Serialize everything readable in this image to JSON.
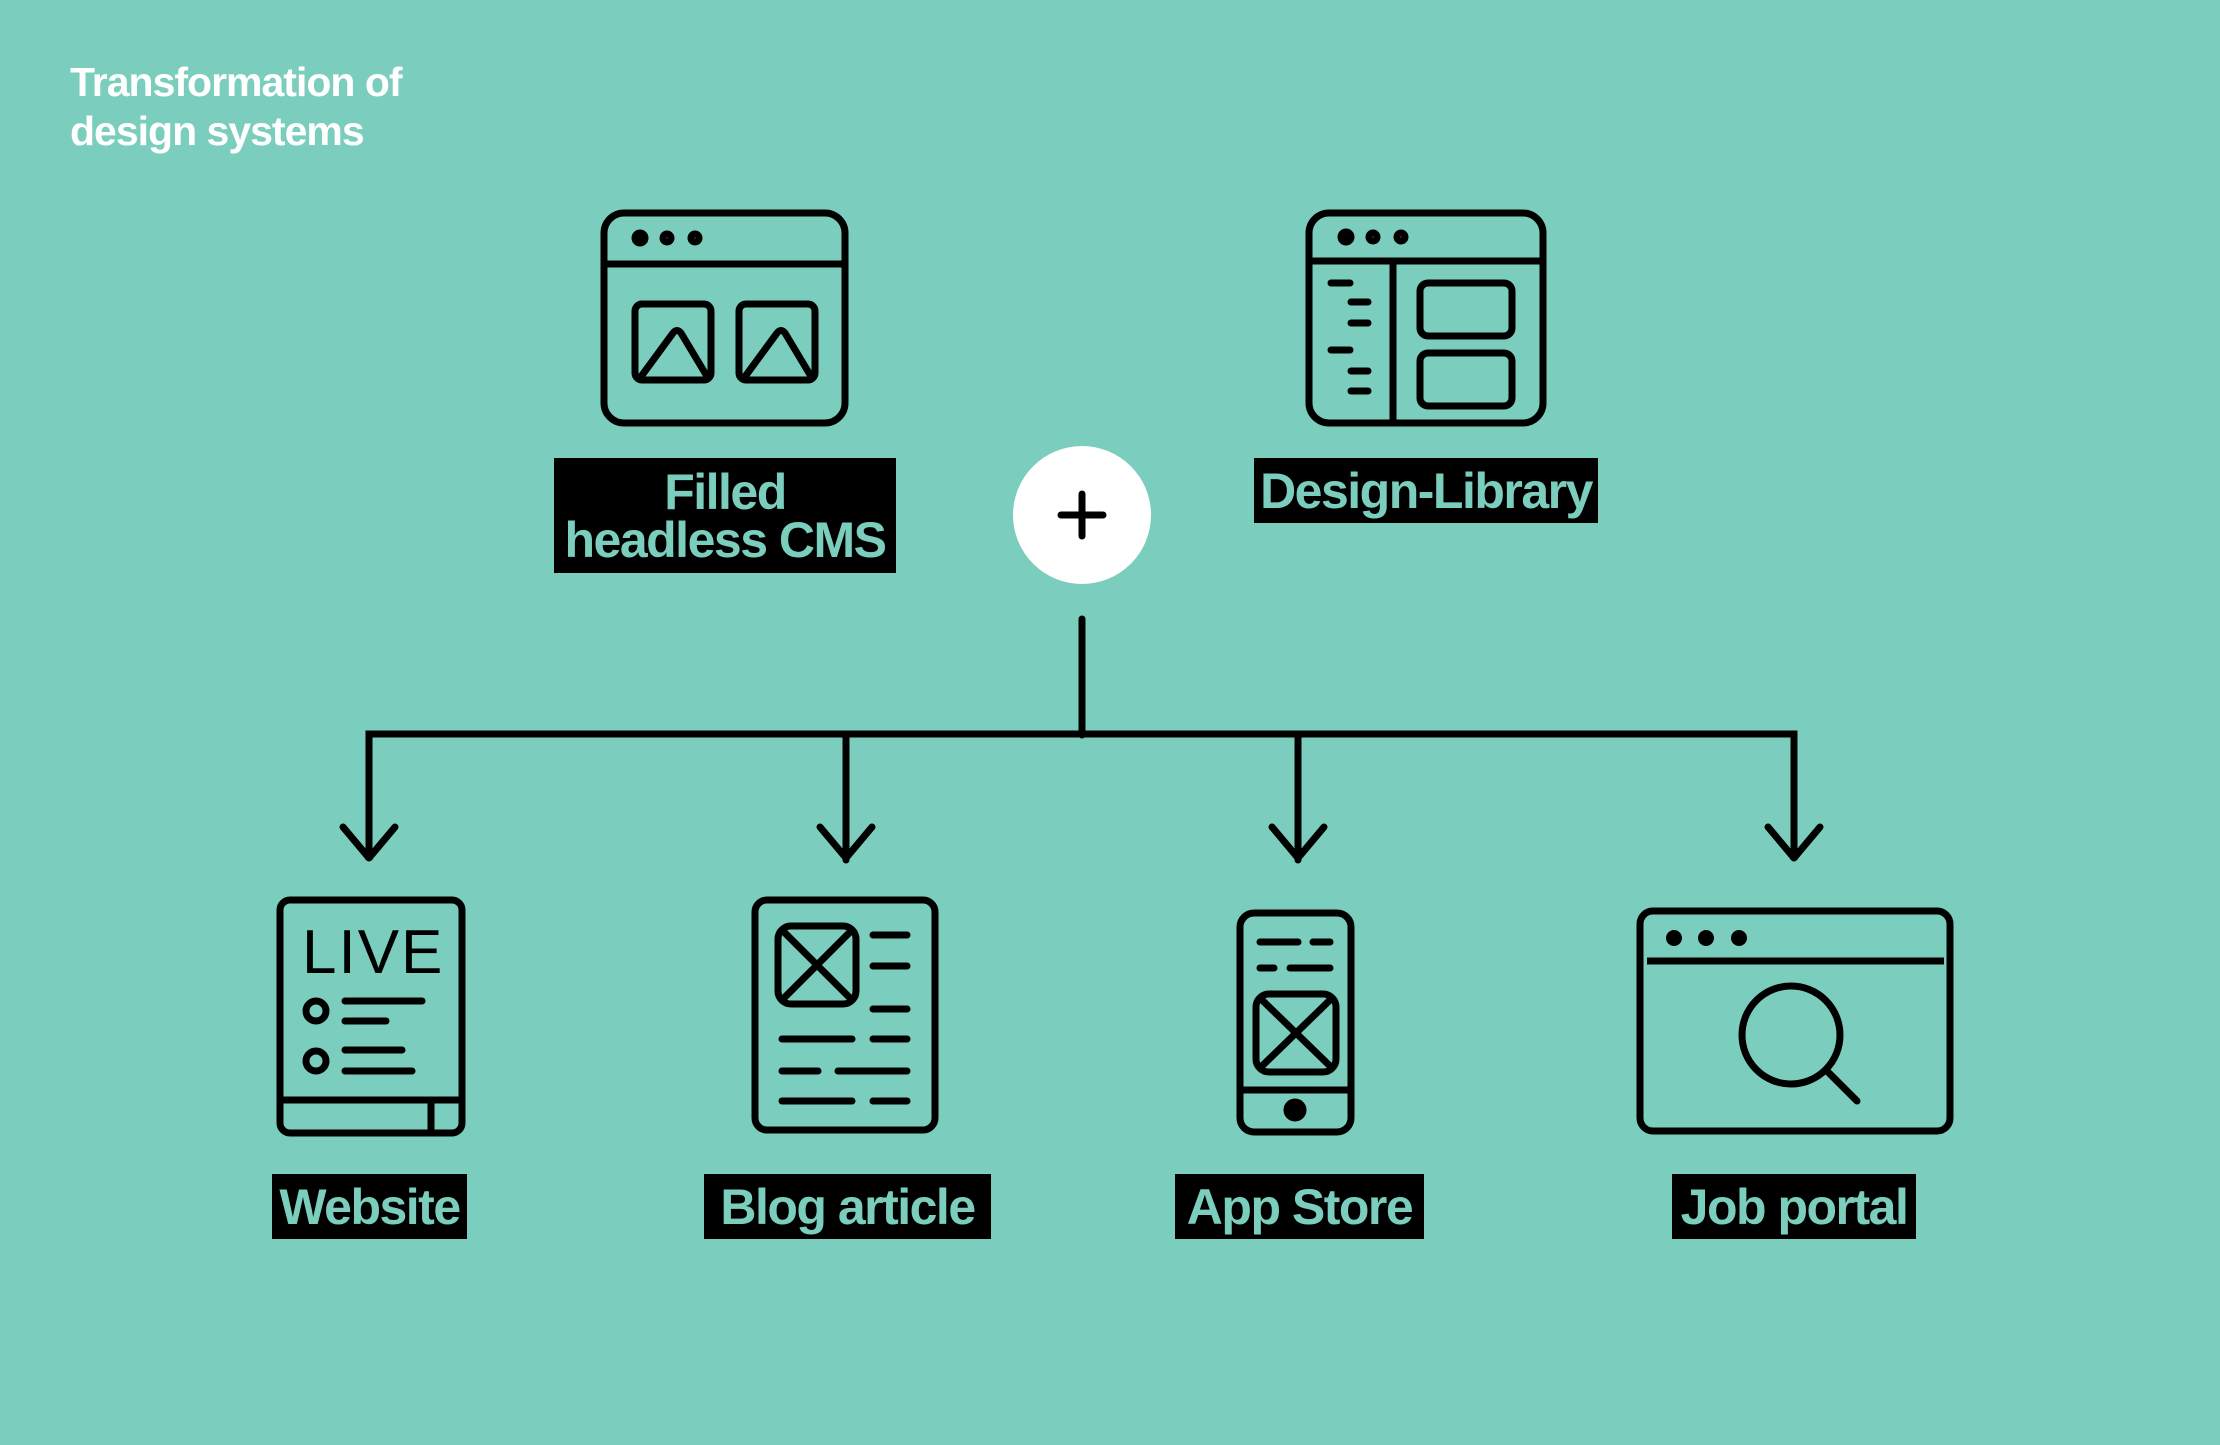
{
  "title": {
    "line1": "Transformation of",
    "line2": "design systems"
  },
  "colors": {
    "background": "#7bcebd",
    "stroke": "#000000",
    "label_bg": "#000000",
    "label_text": "#7bcebd",
    "title_text": "#ffffff",
    "combine_circle": "#ffffff"
  },
  "inputs": [
    {
      "id": "cms",
      "icon": "browser-images-icon",
      "label_line1": "Filled",
      "label_line2": "headless CMS"
    },
    {
      "id": "library",
      "icon": "browser-layout-icon",
      "label": "Design-Library"
    }
  ],
  "combine": {
    "icon": "plus-icon"
  },
  "outputs": [
    {
      "id": "website",
      "icon": "live-page-icon",
      "label": "Website"
    },
    {
      "id": "blog",
      "icon": "article-icon",
      "label": "Blog article"
    },
    {
      "id": "app",
      "icon": "smartphone-icon",
      "label": "App Store"
    },
    {
      "id": "job",
      "icon": "browser-search-icon",
      "label": "Job portal"
    }
  ],
  "live_text": "LIVE"
}
